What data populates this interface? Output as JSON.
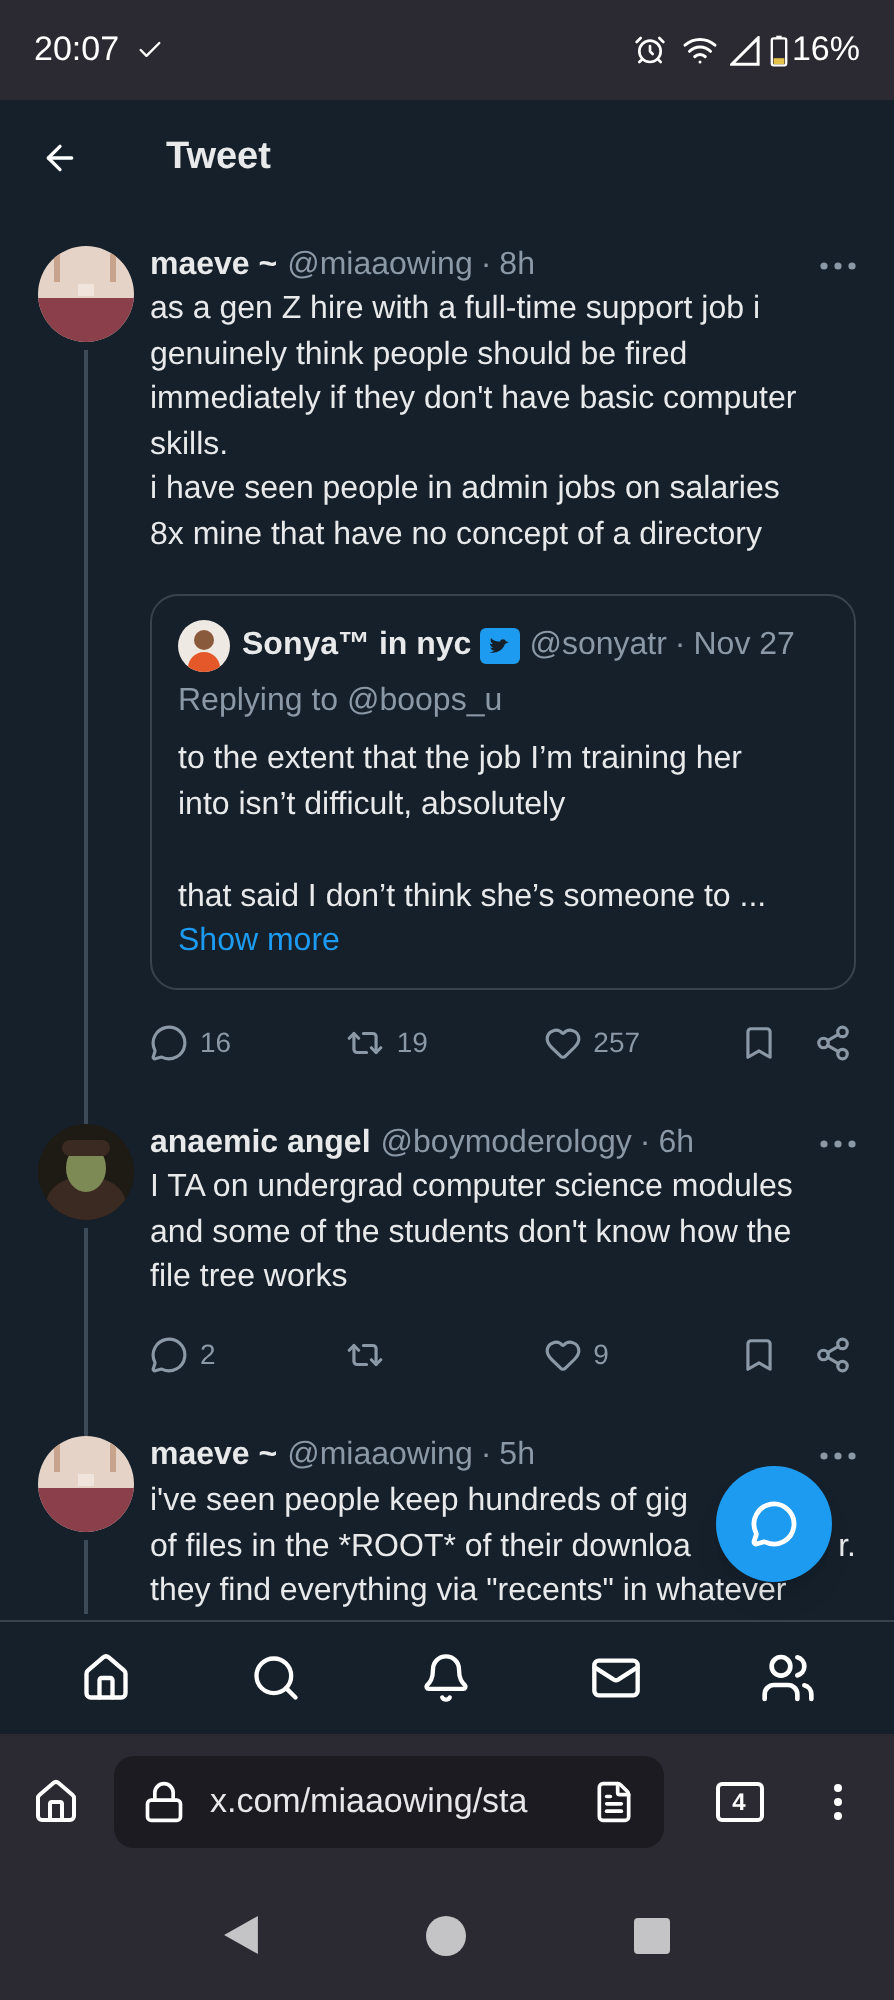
{
  "status_bar": {
    "time": "20:07",
    "battery": "16%"
  },
  "header": {
    "title": "Tweet"
  },
  "tweets": [
    {
      "name": "maeve ~",
      "handle": "@miaaowing",
      "separator": "·",
      "time": "8h",
      "lines": [
        "as a gen Z hire with a full-time support job i",
        "genuinely think people should be fired",
        "immediately if they don't have basic computer",
        "skills.",
        "i have seen people in admin jobs on salaries",
        "8x mine that have no concept of a directory"
      ],
      "quote": {
        "name": "Sonya™ in nyc",
        "handle": "@sonyatr",
        "separator": "·",
        "time": "Nov 27",
        "replying": "Replying to @boops_u",
        "paragraphs": [
          [
            "to the extent that the job I’m training her",
            "into isn’t difficult, absolutely"
          ],
          [
            "that said I don’t think she’s someone to ..."
          ]
        ],
        "show_more": "Show more"
      },
      "stats": [
        {
          "kind": "reply",
          "count": "16"
        },
        {
          "kind": "retweet",
          "count": "19"
        },
        {
          "kind": "like",
          "count": "257"
        },
        {
          "kind": "bookmark"
        },
        {
          "kind": "share"
        }
      ]
    },
    {
      "name": "anaemic angel",
      "handle": "@boymoderology",
      "separator": "·",
      "time": "6h",
      "lines": [
        "I TA on undergrad computer science modules",
        "and some of the students don't know how the",
        "file tree works"
      ],
      "stats": [
        {
          "kind": "reply",
          "count": "2"
        },
        {
          "kind": "retweet"
        },
        {
          "kind": "like",
          "count": "9"
        },
        {
          "kind": "bookmark"
        },
        {
          "kind": "share"
        }
      ]
    },
    {
      "name": "maeve ~",
      "handle": "@miaaowing",
      "separator": "·",
      "time": "5h",
      "covered_lines": [
        {
          "text": "i've seen people keep hundreds of gig"
        },
        {
          "text": "of files in the *ROOT* of their downloa",
          "tail": "r."
        },
        {
          "text": "they find everything via \"recents\" in whatever"
        }
      ]
    }
  ],
  "browser": {
    "url": "x.com/miaaowing/sta",
    "tab_count": "4"
  }
}
